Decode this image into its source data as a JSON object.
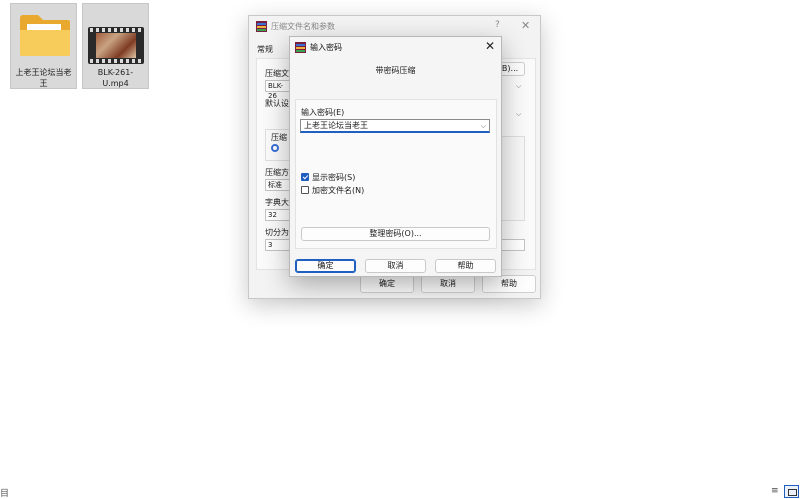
{
  "desktop": {
    "files": [
      {
        "name": "上老王论坛当老王",
        "type": "folder"
      },
      {
        "name": "BLK-261-U.mp4",
        "type": "video"
      }
    ]
  },
  "background_dialog": {
    "title": "压缩文件名和参数",
    "help_glyph": "?",
    "close_glyph": "✕",
    "tab_general": "常规",
    "archive_name_label": "压缩文",
    "archive_name_value": "BLK-26",
    "browse_label": "(B)...",
    "default_profile_label": "默认设",
    "format_group_label": "压缩",
    "method_label": "压缩方",
    "method_value": "标准",
    "dict_label": "字典大",
    "dict_value": "32",
    "split_label": "切分为",
    "split_value": "3",
    "ok_label": "确定",
    "cancel_label": "取消",
    "help_label": "帮助"
  },
  "password_dialog": {
    "title": "输入密码",
    "close_glyph": "✕",
    "subtitle": "带密码压缩",
    "password_label": "输入密码(E)",
    "password_value": "上老王论坛当老王",
    "show_password_label": "显示密码(S)",
    "show_password_checked": true,
    "encrypt_names_label": "加密文件名(N)",
    "encrypt_names_checked": false,
    "organize_label": "整理密码(O)...",
    "ok_label": "确定",
    "cancel_label": "取消",
    "help_label": "帮助"
  },
  "status_bar": {
    "left_glyph": "目",
    "list_view_glyph": "≡"
  },
  "colors": {
    "accent": "#1f5fbf",
    "folder": "#f4c24f",
    "dialog_bg": "#f5f5f5"
  }
}
